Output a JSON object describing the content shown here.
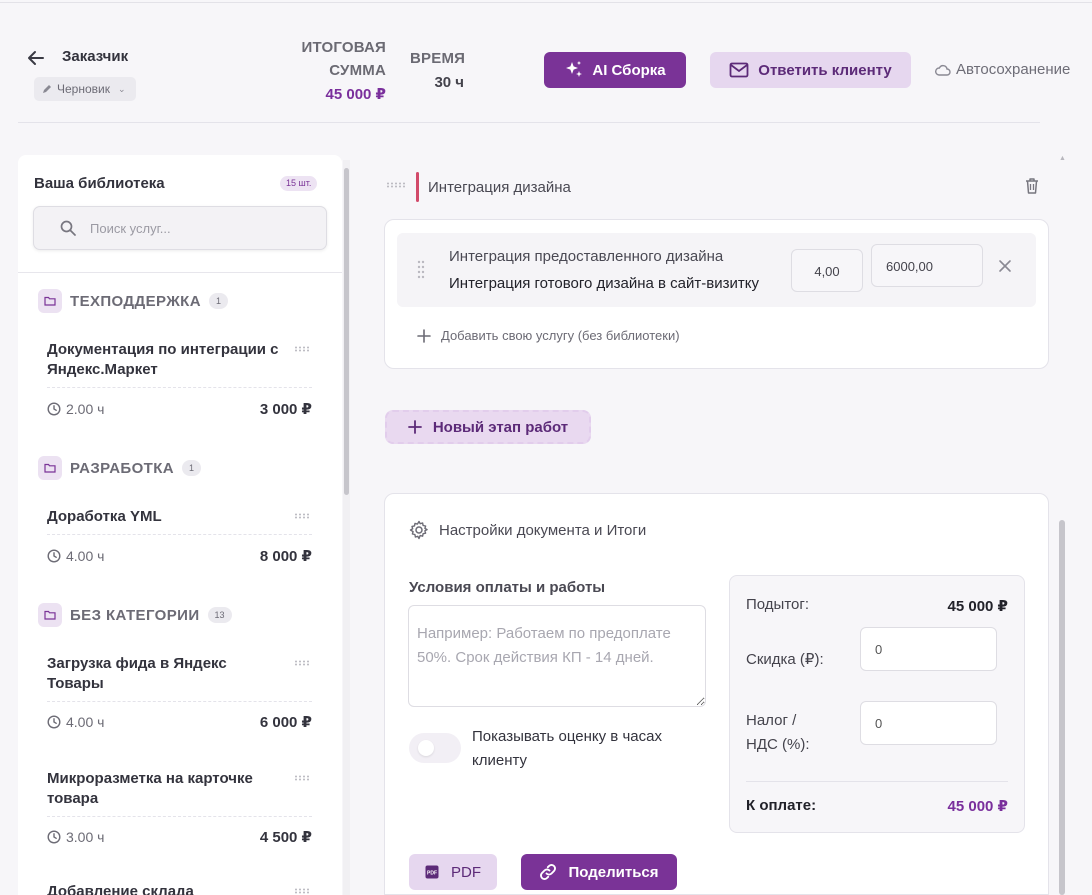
{
  "header": {
    "client_name": "Заказчик",
    "status": "Черновик",
    "total_label_line1": "ИТОГОВАЯ",
    "total_label_line2": "СУММА",
    "total_value": "45 000 ₽",
    "time_label": "ВРЕМЯ",
    "time_value": "30 ч",
    "ai_button": "AI Сборка",
    "reply_button": "Ответить клиенту",
    "autosave": "Автосохранение"
  },
  "sidebar": {
    "title": "Ваша библиотека",
    "count_badge": "15 шт.",
    "search_placeholder": "Поиск услуг...",
    "categories": [
      {
        "name": "ТЕХПОДДЕРЖКА",
        "count": "1",
        "services": [
          {
            "title": "Документация по интеграции с Яндекс.Маркет",
            "time": "2.00 ч",
            "price": "3 000 ₽"
          }
        ]
      },
      {
        "name": "РАЗРАБОТКА",
        "count": "1",
        "services": [
          {
            "title": "Доработка YML",
            "time": "4.00 ч",
            "price": "8 000 ₽"
          }
        ]
      },
      {
        "name": "БЕЗ КАТЕГОРИИ",
        "count": "13",
        "services": [
          {
            "title": "Загрузка фида в Яндекс Товары",
            "time": "4.00 ч",
            "price": "6 000 ₽"
          },
          {
            "title": "Микроразметка на карточке товара",
            "time": "3.00 ч",
            "price": "4 500 ₽"
          },
          {
            "title": "Добавление склада",
            "time": "",
            "price": ""
          }
        ]
      }
    ]
  },
  "stage": {
    "name": "Интеграция дизайна",
    "items": [
      {
        "name": "Интеграция предоставленного дизайна",
        "description": "Интеграция готового дизайна в сайт-визитку",
        "qty": "4,00",
        "price": "6000,00"
      }
    ],
    "add_own_label": "Добавить свою услугу (без библиотеки)"
  },
  "new_stage_button": "Новый этап работ",
  "settings": {
    "title": "Настройки документа и Итоги",
    "conditions_label": "Условия оплаты и работы",
    "conditions_placeholder": "Например: Работаем по предоплате 50%. Срок действия КП - 14 дней.",
    "toggle_label": "Показывать оценку в часах клиенту",
    "subtotal_label": "Подытог:",
    "subtotal_value": "45 000 ₽",
    "discount_label": "Скидка (₽):",
    "discount_value": "0",
    "tax_label_line1": "Налог /",
    "tax_label_line2": "НДС (%):",
    "tax_value": "0",
    "due_label": "К оплате:",
    "due_value": "45 000 ₽",
    "pdf_button": "PDF",
    "pdf_icon_text": "PDF",
    "share_button": "Поделиться"
  }
}
